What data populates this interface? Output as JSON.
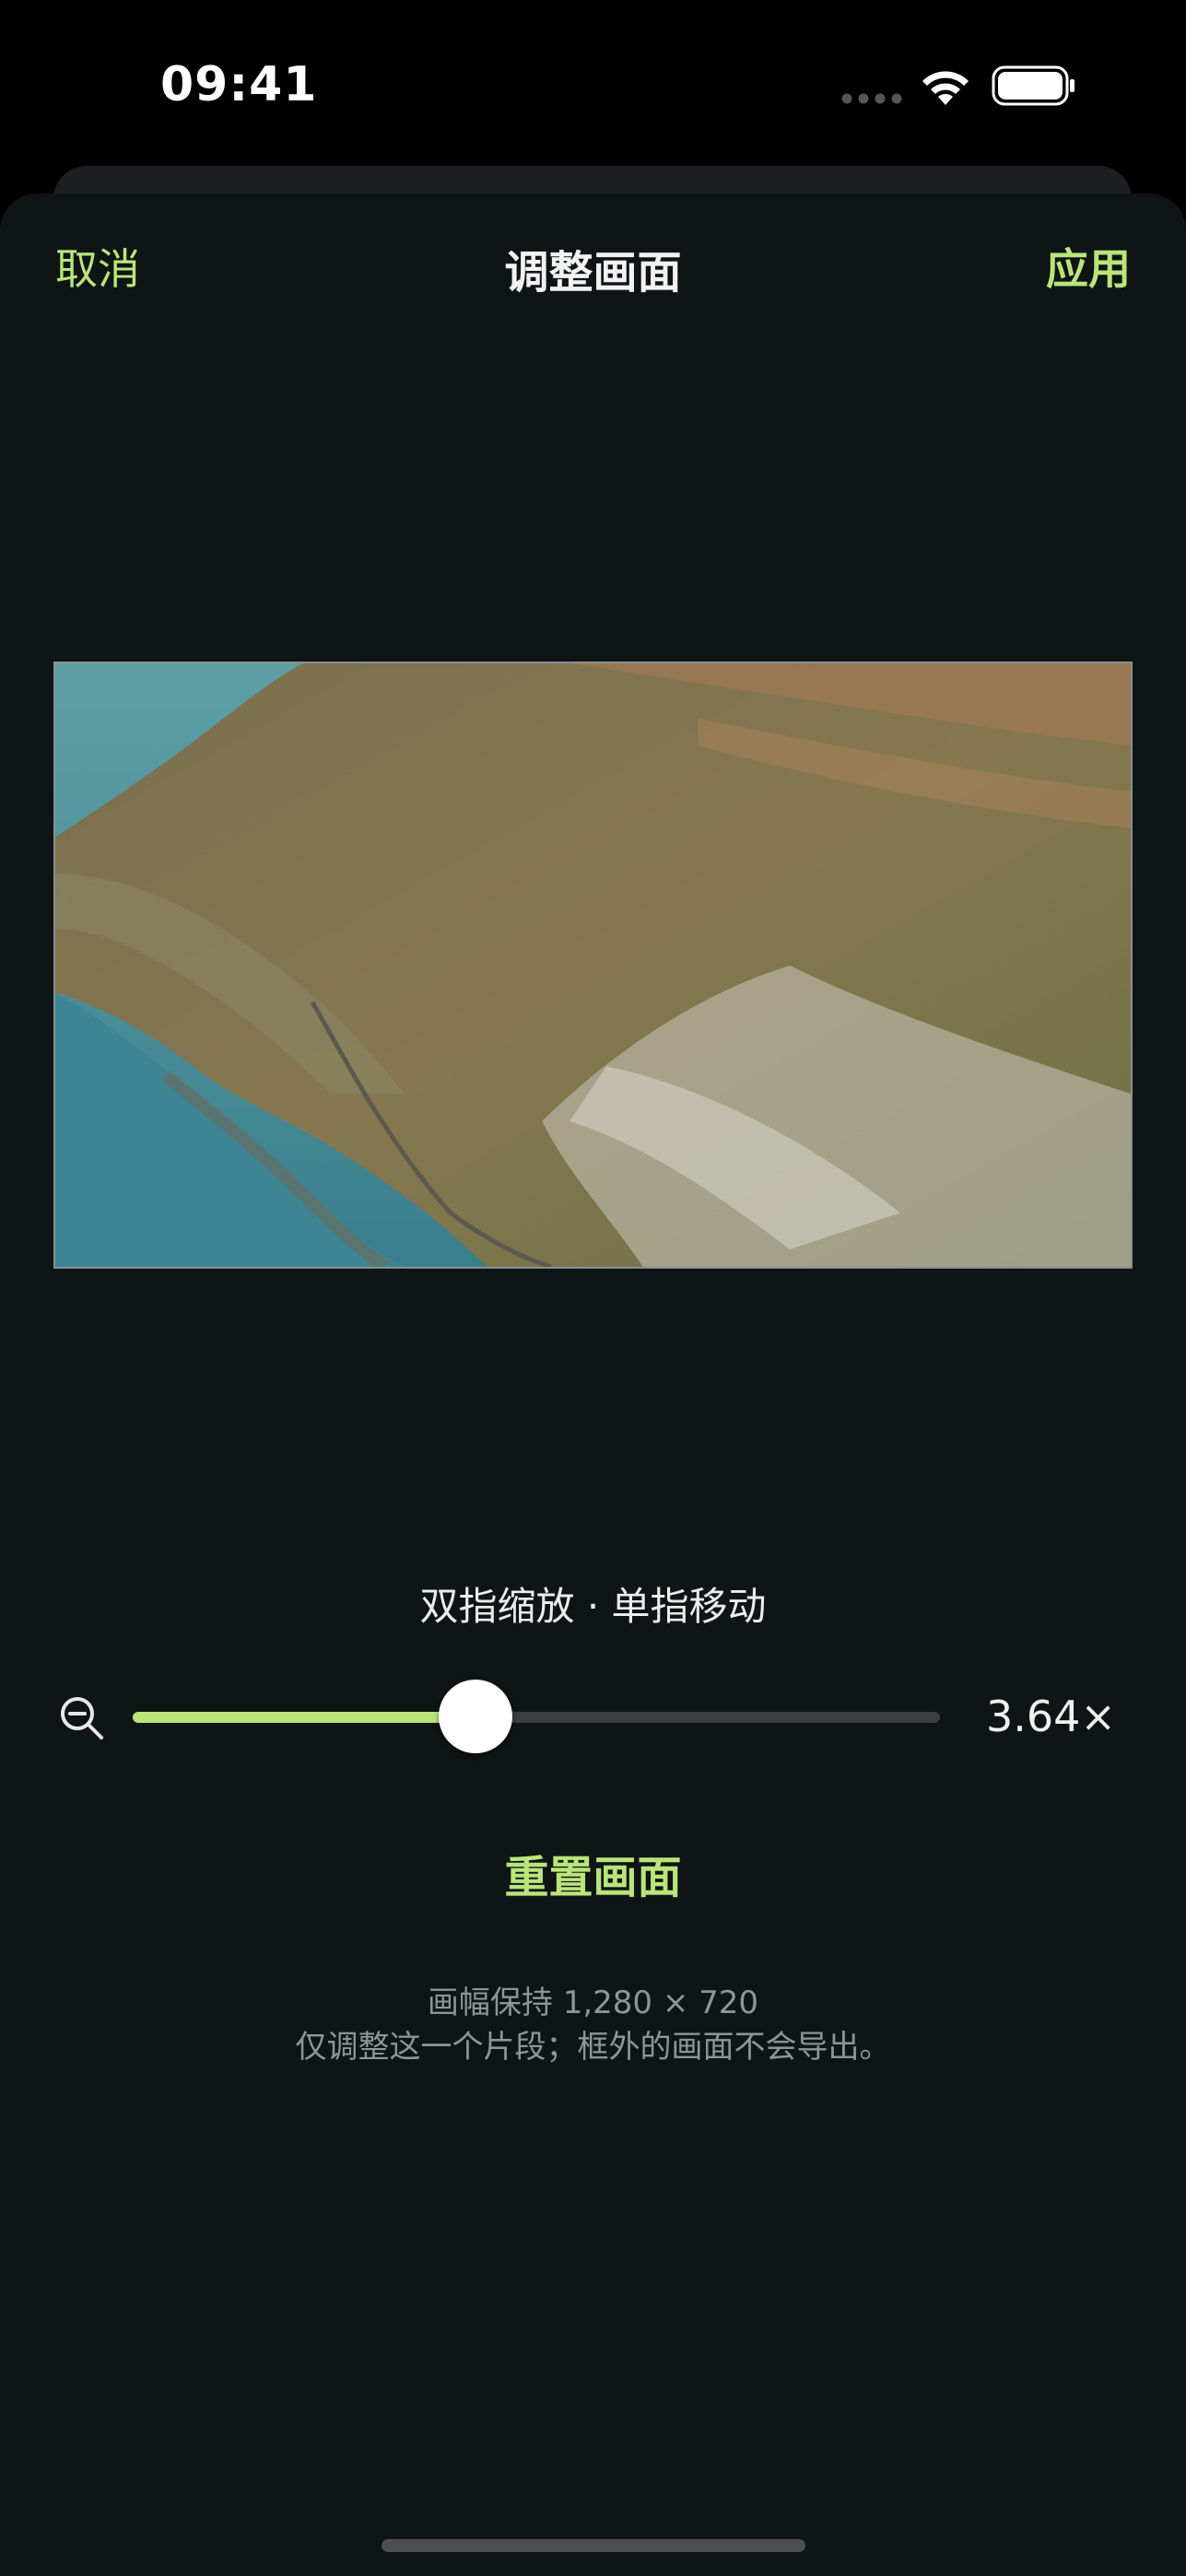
{
  "status_bar": {
    "time": "09:41"
  },
  "nav": {
    "cancel_label": "取消",
    "title": "调整画面",
    "apply_label": "应用"
  },
  "gesture_hint": "双指缩放 · 单指移动",
  "zoom": {
    "value_label": "3.64×",
    "slider_fraction": 0.425,
    "icon": "zoom-out-icon"
  },
  "reset_label": "重置画面",
  "info": {
    "resolution_line": "画幅保持 1,280 × 720",
    "scope_line": "仅调整这一个片段；框外的画面不会导出。"
  },
  "colors": {
    "accent": "#b9e57a",
    "background": "#0f1415",
    "secondary_text": "#8f9496"
  }
}
